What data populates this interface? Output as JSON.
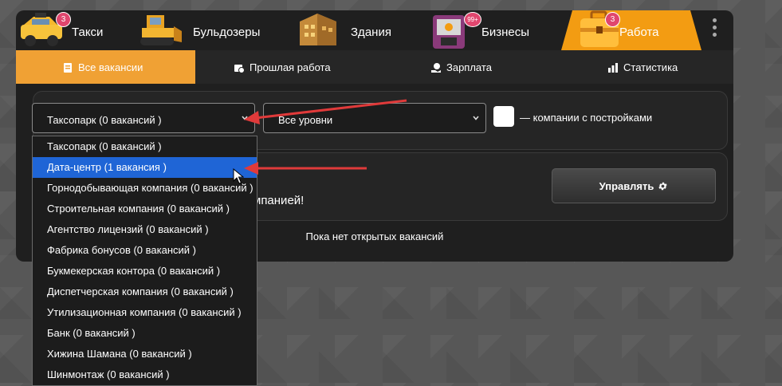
{
  "category_tabs": [
    {
      "label": "Такси",
      "badge": "3",
      "icon": "taxi-icon"
    },
    {
      "label": "Бульдозеры",
      "badge": "",
      "icon": "bulldozer-icon"
    },
    {
      "label": "Здания",
      "badge": "",
      "icon": "building-icon"
    },
    {
      "label": "Бизнесы",
      "badge": "99+",
      "icon": "business-icon"
    },
    {
      "label": "Работа",
      "badge": "3",
      "icon": "briefcase-icon",
      "active": true
    }
  ],
  "sub_tabs": [
    {
      "label": "Все вакансии",
      "icon": "document-icon",
      "active": true
    },
    {
      "label": "Прошлая работа",
      "icon": "history-icon"
    },
    {
      "label": "Зарплата",
      "icon": "money-hand-icon"
    },
    {
      "label": "Статистика",
      "icon": "bar-chart-icon"
    }
  ],
  "filters": {
    "company_select": "Таксопарк (0 вакансий )",
    "level_select": "Все уровни",
    "checkbox_label": "— компании с постройками"
  },
  "company_panel": {
    "hidden_text": "мпанией!",
    "manage_label": "Управлять"
  },
  "empty_text": "Пока нет открытых вакансий",
  "dropdown": {
    "options": [
      "Таксопарк (0 вакансий )",
      "Дата-центр (1 вакансия )",
      "Горнодобывающая компания (0 вакансий )",
      "Строительная компания (0 вакансий )",
      "Агентство лицензий (0 вакансий )",
      "Фабрика бонусов (0 вакансий )",
      "Букмекерская контора (0 вакансий )",
      "Диспетчерская компания (0 вакансий )",
      "Утилизационная компания (0 вакансий )",
      "Банк (0 вакансий )",
      "Хижина Шамана (0 вакансий )",
      "Шинмонтаж (0 вакансий )"
    ],
    "selected_index": 1
  },
  "colors": {
    "accent": "#f39c12",
    "subtab_active": "#f0a134",
    "selected_option": "#1f65d6",
    "badge": "#e0466e",
    "annotation_arrow": "#e03a3a"
  }
}
